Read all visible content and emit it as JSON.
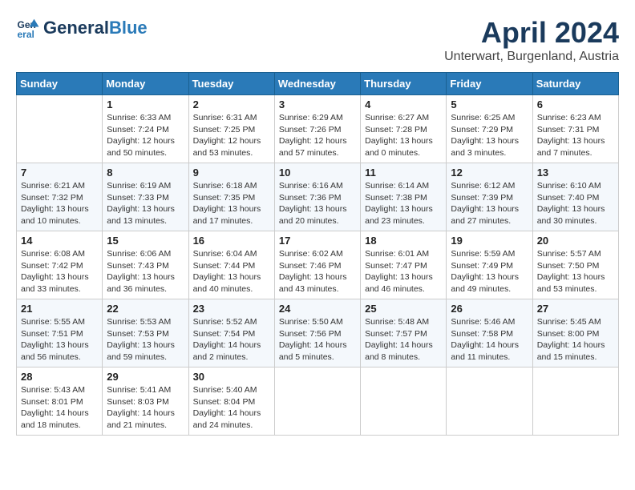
{
  "header": {
    "logo_line1": "General",
    "logo_line2": "Blue",
    "month_title": "April 2024",
    "subtitle": "Unterwart, Burgenland, Austria"
  },
  "days_of_week": [
    "Sunday",
    "Monday",
    "Tuesday",
    "Wednesday",
    "Thursday",
    "Friday",
    "Saturday"
  ],
  "weeks": [
    [
      {
        "day": "",
        "info": ""
      },
      {
        "day": "1",
        "info": "Sunrise: 6:33 AM\nSunset: 7:24 PM\nDaylight: 12 hours\nand 50 minutes."
      },
      {
        "day": "2",
        "info": "Sunrise: 6:31 AM\nSunset: 7:25 PM\nDaylight: 12 hours\nand 53 minutes."
      },
      {
        "day": "3",
        "info": "Sunrise: 6:29 AM\nSunset: 7:26 PM\nDaylight: 12 hours\nand 57 minutes."
      },
      {
        "day": "4",
        "info": "Sunrise: 6:27 AM\nSunset: 7:28 PM\nDaylight: 13 hours\nand 0 minutes."
      },
      {
        "day": "5",
        "info": "Sunrise: 6:25 AM\nSunset: 7:29 PM\nDaylight: 13 hours\nand 3 minutes."
      },
      {
        "day": "6",
        "info": "Sunrise: 6:23 AM\nSunset: 7:31 PM\nDaylight: 13 hours\nand 7 minutes."
      }
    ],
    [
      {
        "day": "7",
        "info": "Sunrise: 6:21 AM\nSunset: 7:32 PM\nDaylight: 13 hours\nand 10 minutes."
      },
      {
        "day": "8",
        "info": "Sunrise: 6:19 AM\nSunset: 7:33 PM\nDaylight: 13 hours\nand 13 minutes."
      },
      {
        "day": "9",
        "info": "Sunrise: 6:18 AM\nSunset: 7:35 PM\nDaylight: 13 hours\nand 17 minutes."
      },
      {
        "day": "10",
        "info": "Sunrise: 6:16 AM\nSunset: 7:36 PM\nDaylight: 13 hours\nand 20 minutes."
      },
      {
        "day": "11",
        "info": "Sunrise: 6:14 AM\nSunset: 7:38 PM\nDaylight: 13 hours\nand 23 minutes."
      },
      {
        "day": "12",
        "info": "Sunrise: 6:12 AM\nSunset: 7:39 PM\nDaylight: 13 hours\nand 27 minutes."
      },
      {
        "day": "13",
        "info": "Sunrise: 6:10 AM\nSunset: 7:40 PM\nDaylight: 13 hours\nand 30 minutes."
      }
    ],
    [
      {
        "day": "14",
        "info": "Sunrise: 6:08 AM\nSunset: 7:42 PM\nDaylight: 13 hours\nand 33 minutes."
      },
      {
        "day": "15",
        "info": "Sunrise: 6:06 AM\nSunset: 7:43 PM\nDaylight: 13 hours\nand 36 minutes."
      },
      {
        "day": "16",
        "info": "Sunrise: 6:04 AM\nSunset: 7:44 PM\nDaylight: 13 hours\nand 40 minutes."
      },
      {
        "day": "17",
        "info": "Sunrise: 6:02 AM\nSunset: 7:46 PM\nDaylight: 13 hours\nand 43 minutes."
      },
      {
        "day": "18",
        "info": "Sunrise: 6:01 AM\nSunset: 7:47 PM\nDaylight: 13 hours\nand 46 minutes."
      },
      {
        "day": "19",
        "info": "Sunrise: 5:59 AM\nSunset: 7:49 PM\nDaylight: 13 hours\nand 49 minutes."
      },
      {
        "day": "20",
        "info": "Sunrise: 5:57 AM\nSunset: 7:50 PM\nDaylight: 13 hours\nand 53 minutes."
      }
    ],
    [
      {
        "day": "21",
        "info": "Sunrise: 5:55 AM\nSunset: 7:51 PM\nDaylight: 13 hours\nand 56 minutes."
      },
      {
        "day": "22",
        "info": "Sunrise: 5:53 AM\nSunset: 7:53 PM\nDaylight: 13 hours\nand 59 minutes."
      },
      {
        "day": "23",
        "info": "Sunrise: 5:52 AM\nSunset: 7:54 PM\nDaylight: 14 hours\nand 2 minutes."
      },
      {
        "day": "24",
        "info": "Sunrise: 5:50 AM\nSunset: 7:56 PM\nDaylight: 14 hours\nand 5 minutes."
      },
      {
        "day": "25",
        "info": "Sunrise: 5:48 AM\nSunset: 7:57 PM\nDaylight: 14 hours\nand 8 minutes."
      },
      {
        "day": "26",
        "info": "Sunrise: 5:46 AM\nSunset: 7:58 PM\nDaylight: 14 hours\nand 11 minutes."
      },
      {
        "day": "27",
        "info": "Sunrise: 5:45 AM\nSunset: 8:00 PM\nDaylight: 14 hours\nand 15 minutes."
      }
    ],
    [
      {
        "day": "28",
        "info": "Sunrise: 5:43 AM\nSunset: 8:01 PM\nDaylight: 14 hours\nand 18 minutes."
      },
      {
        "day": "29",
        "info": "Sunrise: 5:41 AM\nSunset: 8:03 PM\nDaylight: 14 hours\nand 21 minutes."
      },
      {
        "day": "30",
        "info": "Sunrise: 5:40 AM\nSunset: 8:04 PM\nDaylight: 14 hours\nand 24 minutes."
      },
      {
        "day": "",
        "info": ""
      },
      {
        "day": "",
        "info": ""
      },
      {
        "day": "",
        "info": ""
      },
      {
        "day": "",
        "info": ""
      }
    ]
  ]
}
